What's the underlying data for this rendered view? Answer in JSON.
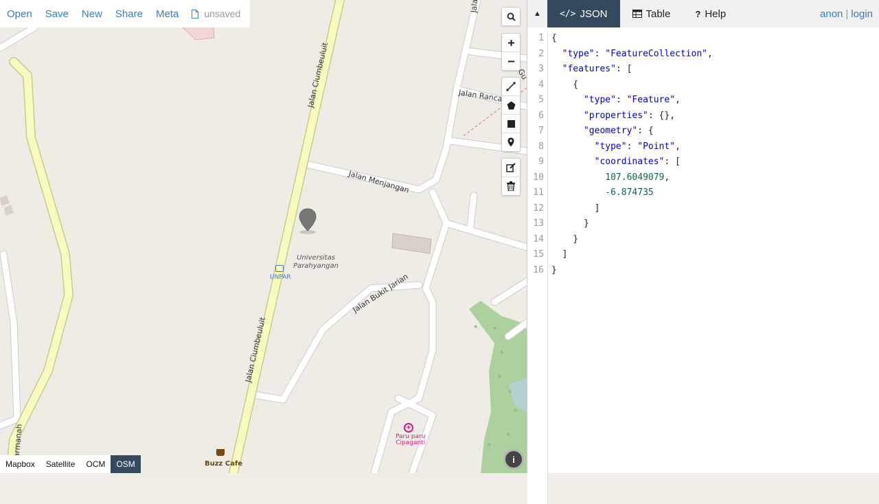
{
  "menu": {
    "items": [
      "Open",
      "Save",
      "New",
      "Share",
      "Meta"
    ],
    "doc_status": "unsaved"
  },
  "map": {
    "streets": {
      "ciumbeuluit": "Jalan Ciumbeuluit",
      "menjangan": "Jalan Menjangan",
      "rancab": "Jalan Rancab",
      "bukit_jarian": "Jalan Bukit Jarian",
      "gu": "Gu",
      "jala": "Jala",
      "armanah": "armanah"
    },
    "places": {
      "university": "Universitas Parahyangan",
      "bus_stop": "UNPAR",
      "cafe": "Buzz Cafe",
      "clinic_line1": "Paru paru",
      "clinic_line2": "Cipaganti"
    },
    "marker_color": "#777777"
  },
  "layers": {
    "items": [
      "Mapbox",
      "Satellite",
      "OCM",
      "OSM"
    ],
    "active": "OSM"
  },
  "pane": {
    "tabs": [
      {
        "label": "JSON",
        "icon": "code-icon",
        "active": true
      },
      {
        "label": "Table",
        "icon": "table-icon",
        "active": false
      },
      {
        "label": "Help",
        "icon": "question-icon",
        "active": false
      }
    ],
    "user": "anon",
    "separator": "|",
    "login": "login"
  },
  "editor": {
    "lines": [
      {
        "n": "1"
      },
      {
        "n": "2"
      },
      {
        "n": "3"
      },
      {
        "n": "4"
      },
      {
        "n": "5"
      },
      {
        "n": "6"
      },
      {
        "n": "7"
      },
      {
        "n": "8"
      },
      {
        "n": "9"
      },
      {
        "n": "10"
      },
      {
        "n": "11"
      },
      {
        "n": "12"
      },
      {
        "n": "13"
      },
      {
        "n": "14"
      },
      {
        "n": "15"
      },
      {
        "n": "16"
      }
    ],
    "geojson": {
      "type_key": "\"type\"",
      "type_val": "\"FeatureCollection\"",
      "features_key": "\"features\"",
      "feature_type_val": "\"Feature\"",
      "properties_key": "\"properties\"",
      "geometry_key": "\"geometry\"",
      "point_val": "\"Point\"",
      "coordinates_key": "\"coordinates\"",
      "lon": "107.6049079",
      "lat": "-6.874735"
    }
  },
  "colors": {
    "accent": "#34495e",
    "link": "#3a7dc2",
    "primary_road": "#f7fabf",
    "road_casing": "#d6d0a0",
    "park": "#add19e"
  }
}
